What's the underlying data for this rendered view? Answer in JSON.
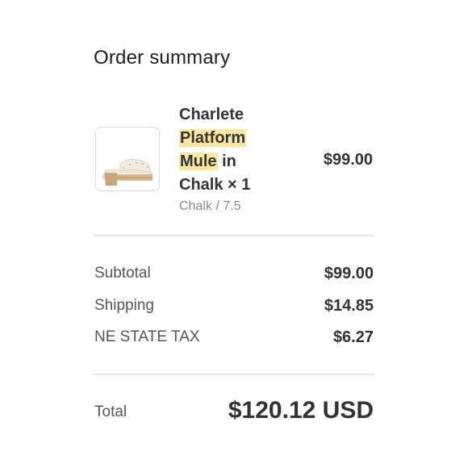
{
  "summary": {
    "title": "Order summary"
  },
  "item": {
    "name_part1": "Charlete",
    "name_highlight1": "Platform",
    "name_highlight2": "Mule",
    "name_part2": "in Chalk × 1",
    "variant": "Chalk / 7.5",
    "price": "$99.00",
    "image_icon": "sandal-product-image",
    "highlight_color": "#fbe7a3"
  },
  "totals": {
    "subtotal_label": "Subtotal",
    "subtotal_value": "$99.00",
    "shipping_label": "Shipping",
    "shipping_value": "$14.85",
    "tax_label": "NE STATE TAX",
    "tax_value": "$6.27",
    "total_label": "Total",
    "total_value": "$120.12 USD"
  }
}
